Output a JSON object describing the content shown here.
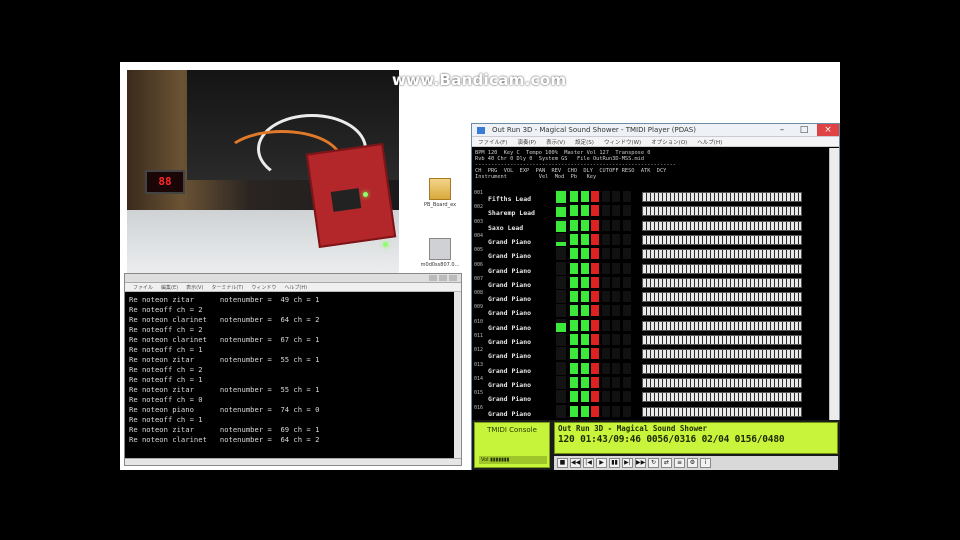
{
  "watermark": "www.Bandicam.com",
  "desktop_icons": [
    {
      "label": "PB_Board_ex"
    },
    {
      "label": "m0d0ss807.0..."
    }
  ],
  "console": {
    "menu": [
      "ファイル",
      "編集(E)",
      "表示(V)",
      "ターミナル(T)",
      "ウィンドウ",
      "ヘルプ(H)"
    ],
    "lines": [
      "Re noteon zitar      notenumber =  49 ch = 1",
      "Re noteoff ch = 2",
      "Re noteon clarinet   notenumber =  64 ch = 2",
      "Re noteoff ch = 2",
      "Re noteon clarinet   notenumber =  67 ch = 1",
      "Re noteoff ch = 1",
      "Re noteon zitar      notenumber =  55 ch = 1",
      "Re noteoff ch = 2",
      "Re noteoff ch = 1",
      "Re noteon zitar      notenumber =  55 ch = 1",
      "Re noteoff ch = 0",
      "Re noteon piano      notenumber =  74 ch = 0",
      "Re noteoff ch = 1",
      "Re noteon zitar      notenumber =  69 ch = 1",
      "Re noteon clarinet   notenumber =  64 ch = 2"
    ]
  },
  "player": {
    "title": "Out Run 3D - Magical Sound Shower - TMIDI Player (PDAS)",
    "menu": [
      "ファイル(F)",
      "演奏(P)",
      "表示(V)",
      "設定(S)",
      "ウィンドウ(W)",
      "オプション(O)",
      "ヘルプ(H)"
    ],
    "tracks": [
      {
        "num": "001",
        "name": "Fifths Lead",
        "level": 0.9
      },
      {
        "num": "002",
        "name": "Sharemp Lead",
        "level": 0.8
      },
      {
        "num": "003",
        "name": "Saxo Lead",
        "level": 0.85
      },
      {
        "num": "004",
        "name": "Grand Piano",
        "level": 0.3
      },
      {
        "num": "005",
        "name": "Grand Piano",
        "level": 0.0
      },
      {
        "num": "006",
        "name": "Grand Piano",
        "level": 0.0
      },
      {
        "num": "007",
        "name": "Grand Piano",
        "level": 0.0
      },
      {
        "num": "008",
        "name": "Grand Piano",
        "level": 0.0
      },
      {
        "num": "009",
        "name": "Grand Piano",
        "level": 0.0
      },
      {
        "num": "010",
        "name": "Grand Piano",
        "level": 0.7
      },
      {
        "num": "011",
        "name": "Grand Piano",
        "level": 0.0
      },
      {
        "num": "012",
        "name": "Grand Piano",
        "level": 0.0
      },
      {
        "num": "013",
        "name": "Grand Piano",
        "level": 0.0
      },
      {
        "num": "014",
        "name": "Grand Piano",
        "level": 0.0
      },
      {
        "num": "015",
        "name": "Grand Piano",
        "level": 0.0
      },
      {
        "num": "016",
        "name": "Grand Piano",
        "level": 0.0
      }
    ],
    "logo_title": "TMIDI Console",
    "song_title": "Out Run 3D - Magical Sound Shower",
    "bpm": "120",
    "time": "01:43/09:46",
    "measure": "0056/0316",
    "beat": "02/04 0156/0480"
  }
}
